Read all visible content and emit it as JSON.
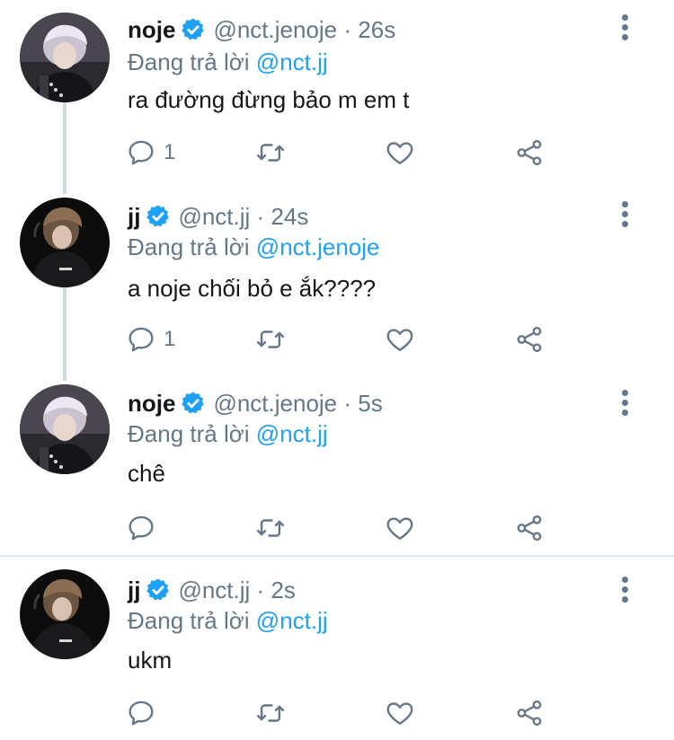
{
  "colors": {
    "accent": "#1da1f2",
    "secondary_text": "#657786",
    "primary_text": "#14171a"
  },
  "reply_prefix": "Đang trả lời",
  "tweets": [
    {
      "name": "noje",
      "handle": "@nct.jenoje",
      "separator": "·",
      "time": "26s",
      "reply_to": "@nct.jj",
      "text": "ra đường đừng bảo m em t",
      "reply_count": "1",
      "avatar": "noje-avatar"
    },
    {
      "name": "jj",
      "handle": "@nct.jj",
      "separator": "·",
      "time": "24s",
      "reply_to": "@nct.jenoje",
      "text": "a noje chối bỏ e ắk????",
      "reply_count": "1",
      "avatar": "jj-avatar"
    },
    {
      "name": "noje",
      "handle": "@nct.jenoje",
      "separator": "·",
      "time": "5s",
      "reply_to": "@nct.jj",
      "text": "chê",
      "reply_count": "",
      "avatar": "noje-avatar"
    },
    {
      "name": "jj",
      "handle": "@nct.jj",
      "separator": "·",
      "time": "2s",
      "reply_to": "@nct.jj",
      "text": "ukm",
      "reply_count": "",
      "avatar": "jj-avatar"
    }
  ],
  "icons": {
    "verified": "verified-badge-icon",
    "more": "more-vertical-icon",
    "reply": "comment-icon",
    "retweet": "retweet-icon",
    "like": "heart-icon",
    "share": "share-icon"
  }
}
